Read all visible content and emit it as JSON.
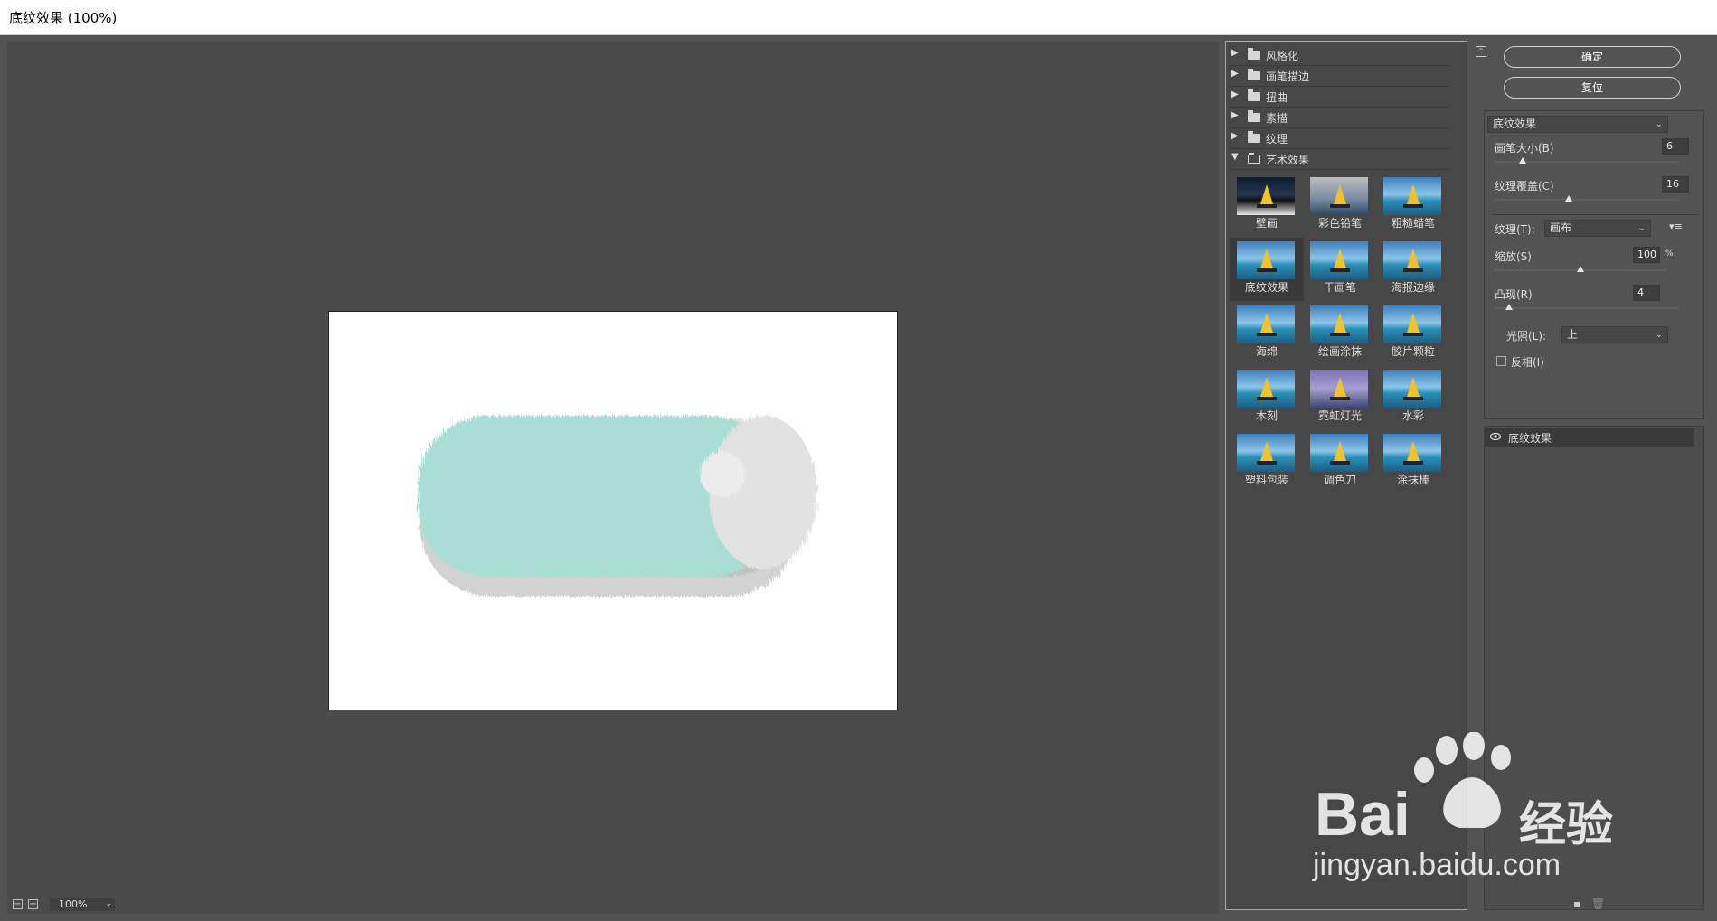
{
  "window": {
    "title": "底纹效果 (100%)"
  },
  "status": {
    "zoom_out": "−",
    "zoom_in": "+",
    "zoom": "100%"
  },
  "gallery": {
    "categories": [
      {
        "label": "风格化",
        "open": false
      },
      {
        "label": "画笔描边",
        "open": false
      },
      {
        "label": "扭曲",
        "open": false
      },
      {
        "label": "素描",
        "open": false
      },
      {
        "label": "纹理",
        "open": false
      },
      {
        "label": "艺术效果",
        "open": true
      }
    ],
    "filters": [
      "壁画",
      "彩色铅笔",
      "粗糙蜡笔",
      "底纹效果",
      "干画笔",
      "海报边缘",
      "海绵",
      "绘画涂抹",
      "胶片颗粒",
      "木刻",
      "霓虹灯光",
      "水彩",
      "塑料包装",
      "调色刀",
      "涂抹棒"
    ],
    "selected": "底纹效果"
  },
  "buttons": {
    "ok": "确定",
    "reset": "复位"
  },
  "settings": {
    "filter": "底纹效果",
    "brush_size_label": "画笔大小(B)",
    "brush_size": "6",
    "brush_size_level": 0.15,
    "coverage_label": "纹理覆盖(C)",
    "coverage": "16",
    "coverage_level": 0.4,
    "texture_label": "纹理(T):",
    "texture": "画布",
    "scaling_label": "缩放(S)",
    "scaling": "100",
    "scaling_unit": "%",
    "scaling_level": 0.5,
    "relief_label": "凸现(R)",
    "relief": "4",
    "relief_level": 0.08,
    "light_label": "光照(L):",
    "light": "上",
    "invert_label": "反相(I)",
    "invert": false
  },
  "layers": [
    {
      "name": "底纹效果",
      "visible": true
    }
  ],
  "watermark": {
    "brand": "Bai",
    "brand_cn": "经验",
    "url": "jingyan.baidu.com"
  },
  "colors": {
    "accent_teal": "#a8ded3",
    "ui_bg": "#535353",
    "panel_bg": "#474747"
  }
}
